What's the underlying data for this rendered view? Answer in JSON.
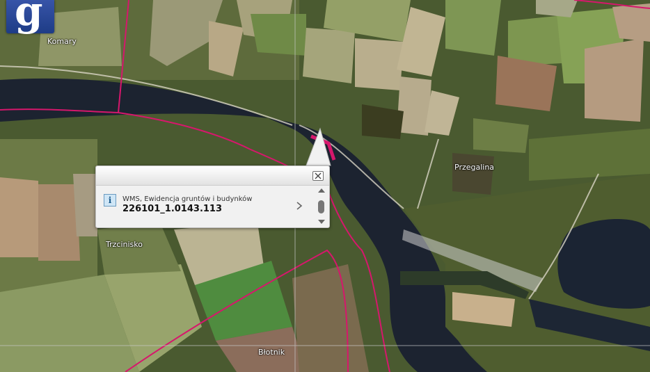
{
  "map": {
    "place_labels": [
      {
        "id": "komary",
        "text": "Komary"
      },
      {
        "id": "przegalina",
        "text": "Przegalina"
      },
      {
        "id": "trzcinisko",
        "text": "Trzcinisko"
      },
      {
        "id": "blotnik",
        "text": "Błotnik"
      }
    ],
    "colors": {
      "river": "#1c2330",
      "field": "#7e8a52",
      "forest": "#33451f",
      "boundary": "#d6176c"
    }
  },
  "logo": {
    "glyph": "g",
    "color": "#2c4a9c"
  },
  "popup": {
    "layer_name": "WMS, Ewidencja gruntów i budynków",
    "parcel_id": "226101_1.0143.113",
    "icons": {
      "info": "info-icon",
      "close": "close-icon",
      "next": "chevron-right-icon"
    }
  }
}
